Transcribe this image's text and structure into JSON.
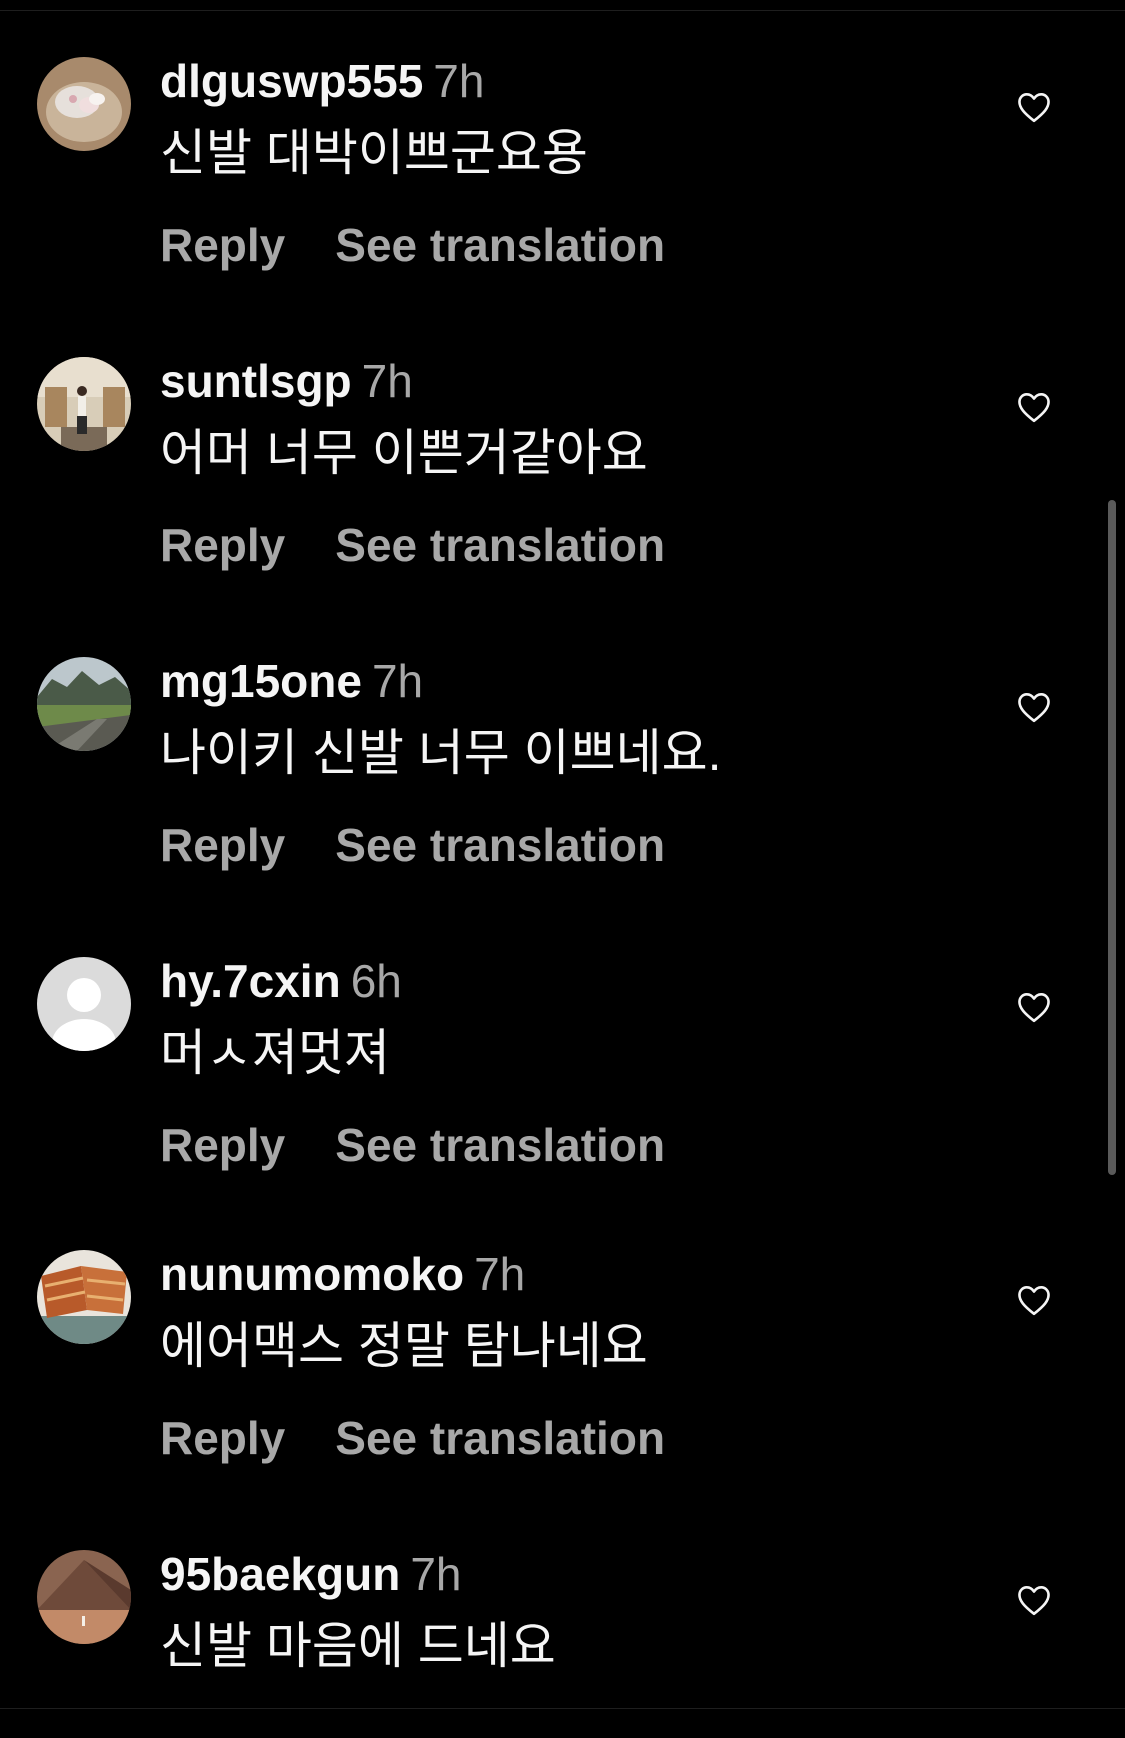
{
  "comments": [
    {
      "username": "dlguswp555",
      "time": "7h",
      "text": "신발 대박이쁘군요용",
      "reply_label": "Reply",
      "translate_label": "See translation",
      "avatar_icon": "pet-photo-avatar",
      "liked": false
    },
    {
      "username": "suntlsgp",
      "time": "7h",
      "text": "어머 너무 이쁜거같아요",
      "reply_label": "Reply",
      "translate_label": "See translation",
      "avatar_icon": "person-room-photo-avatar",
      "liked": false
    },
    {
      "username": "mg15one",
      "time": "7h",
      "text": "나이키 신발 너무 이쁘네요.",
      "reply_label": "Reply",
      "translate_label": "See translation",
      "avatar_icon": "mountain-landscape-avatar",
      "liked": false
    },
    {
      "username": "hy.7cxin",
      "time": "6h",
      "text": "머ㅅ져멋져",
      "reply_label": "Reply",
      "translate_label": "See translation",
      "avatar_icon": "default-user-avatar",
      "liked": false
    },
    {
      "username": "nunumomoko",
      "time": "7h",
      "text": "에어맥스 정말 탐나네요",
      "reply_label": "Reply",
      "translate_label": "See translation",
      "avatar_icon": "food-photo-avatar",
      "liked": false
    },
    {
      "username": "95baekgun",
      "time": "7h",
      "text": "신발 마음에 드네요",
      "reply_label": "",
      "translate_label": "",
      "avatar_icon": "desert-architecture-avatar",
      "liked": false
    }
  ],
  "colors": {
    "background": "#000000",
    "primary_text": "#f5f5f5",
    "secondary_text": "#a8a8a8",
    "scrollbar": "#5a5a5a"
  }
}
